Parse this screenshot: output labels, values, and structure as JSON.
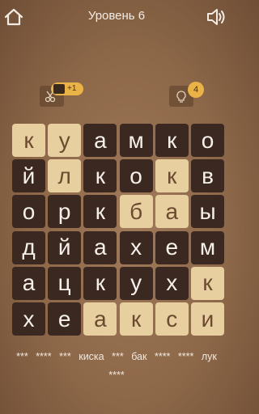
{
  "header": {
    "title": "Уровень 6"
  },
  "hints": {
    "film_bonus": "+1",
    "bulb_count": "4"
  },
  "grid": [
    [
      {
        "l": "к",
        "s": 1
      },
      {
        "l": "у",
        "s": 1
      },
      {
        "l": "а",
        "s": 0
      },
      {
        "l": "м",
        "s": 0
      },
      {
        "l": "к",
        "s": 0
      },
      {
        "l": "о",
        "s": 0
      }
    ],
    [
      {
        "l": "й",
        "s": 0
      },
      {
        "l": "л",
        "s": 1
      },
      {
        "l": "к",
        "s": 0
      },
      {
        "l": "о",
        "s": 0
      },
      {
        "l": "к",
        "s": 1
      },
      {
        "l": "в",
        "s": 0
      }
    ],
    [
      {
        "l": "о",
        "s": 0
      },
      {
        "l": "р",
        "s": 0
      },
      {
        "l": "к",
        "s": 0
      },
      {
        "l": "б",
        "s": 1
      },
      {
        "l": "а",
        "s": 1
      },
      {
        "l": "ы",
        "s": 0
      }
    ],
    [
      {
        "l": "д",
        "s": 0
      },
      {
        "l": "й",
        "s": 0
      },
      {
        "l": "а",
        "s": 0
      },
      {
        "l": "х",
        "s": 0
      },
      {
        "l": "е",
        "s": 0
      },
      {
        "l": "м",
        "s": 0
      }
    ],
    [
      {
        "l": "а",
        "s": 0
      },
      {
        "l": "ц",
        "s": 0
      },
      {
        "l": "к",
        "s": 0
      },
      {
        "l": "у",
        "s": 0
      },
      {
        "l": "х",
        "s": 0
      },
      {
        "l": "к",
        "s": 1
      }
    ],
    [
      {
        "l": "х",
        "s": 0
      },
      {
        "l": "е",
        "s": 0
      },
      {
        "l": "а",
        "s": 1
      },
      {
        "l": "к",
        "s": 1
      },
      {
        "l": "с",
        "s": 1
      },
      {
        "l": "и",
        "s": 1
      }
    ]
  ],
  "words": [
    "***",
    "****",
    "***",
    "киска",
    "***",
    "бак",
    "****",
    "****",
    "лук",
    "****"
  ],
  "colors": {
    "dark_tile": "#3b2820",
    "light_tile": "#e7cfa0",
    "badge": "#e9b348"
  }
}
